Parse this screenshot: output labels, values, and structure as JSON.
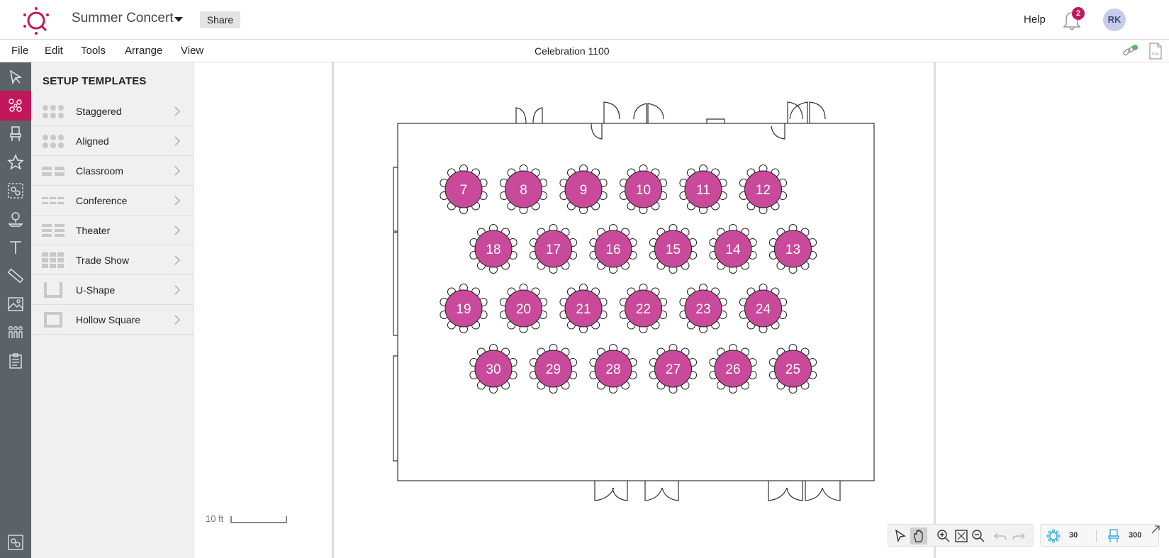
{
  "header": {
    "project_title": "Summer Concert",
    "share_label": "Share",
    "help_label": "Help",
    "notification_count": "2",
    "user_initials": "RK",
    "brand_color": "#c2185b"
  },
  "menu": {
    "items": [
      "File",
      "Edit",
      "Tools",
      "Arrange",
      "View"
    ],
    "document_name": "Celebration 1100"
  },
  "toolrail": {
    "tools": [
      "select-pointer-icon",
      "setup-templates-icon",
      "chair-icon",
      "star-icon",
      "group-icon",
      "place-marker-icon",
      "text-icon",
      "ruler-icon",
      "image-icon",
      "people-icon",
      "clipboard-icon"
    ],
    "active": "setup-templates-icon",
    "bottom_tool": "layout-settings-icon"
  },
  "panel": {
    "title": "SETUP TEMPLATES",
    "templates": [
      {
        "label": "Staggered",
        "icon": "staggered-icon"
      },
      {
        "label": "Aligned",
        "icon": "aligned-icon"
      },
      {
        "label": "Classroom",
        "icon": "classroom-icon"
      },
      {
        "label": "Conference",
        "icon": "conference-icon"
      },
      {
        "label": "Theater",
        "icon": "theater-icon"
      },
      {
        "label": "Trade Show",
        "icon": "trade-show-icon"
      },
      {
        "label": "U-Shape",
        "icon": "u-shape-icon"
      },
      {
        "label": "Hollow Square",
        "icon": "hollow-square-icon"
      }
    ]
  },
  "floorplan": {
    "table_color": "#c9499a",
    "rows": [
      [
        "7",
        "8",
        "9",
        "10",
        "11",
        "12"
      ],
      [
        "18",
        "17",
        "16",
        "15",
        "14",
        "13"
      ],
      [
        "19",
        "20",
        "21",
        "22",
        "23",
        "24"
      ],
      [
        "30",
        "29",
        "28",
        "27",
        "26",
        "25"
      ]
    ],
    "scale_label": "10 ft"
  },
  "bottom": {
    "table_count": "30",
    "seat_count": "300"
  }
}
